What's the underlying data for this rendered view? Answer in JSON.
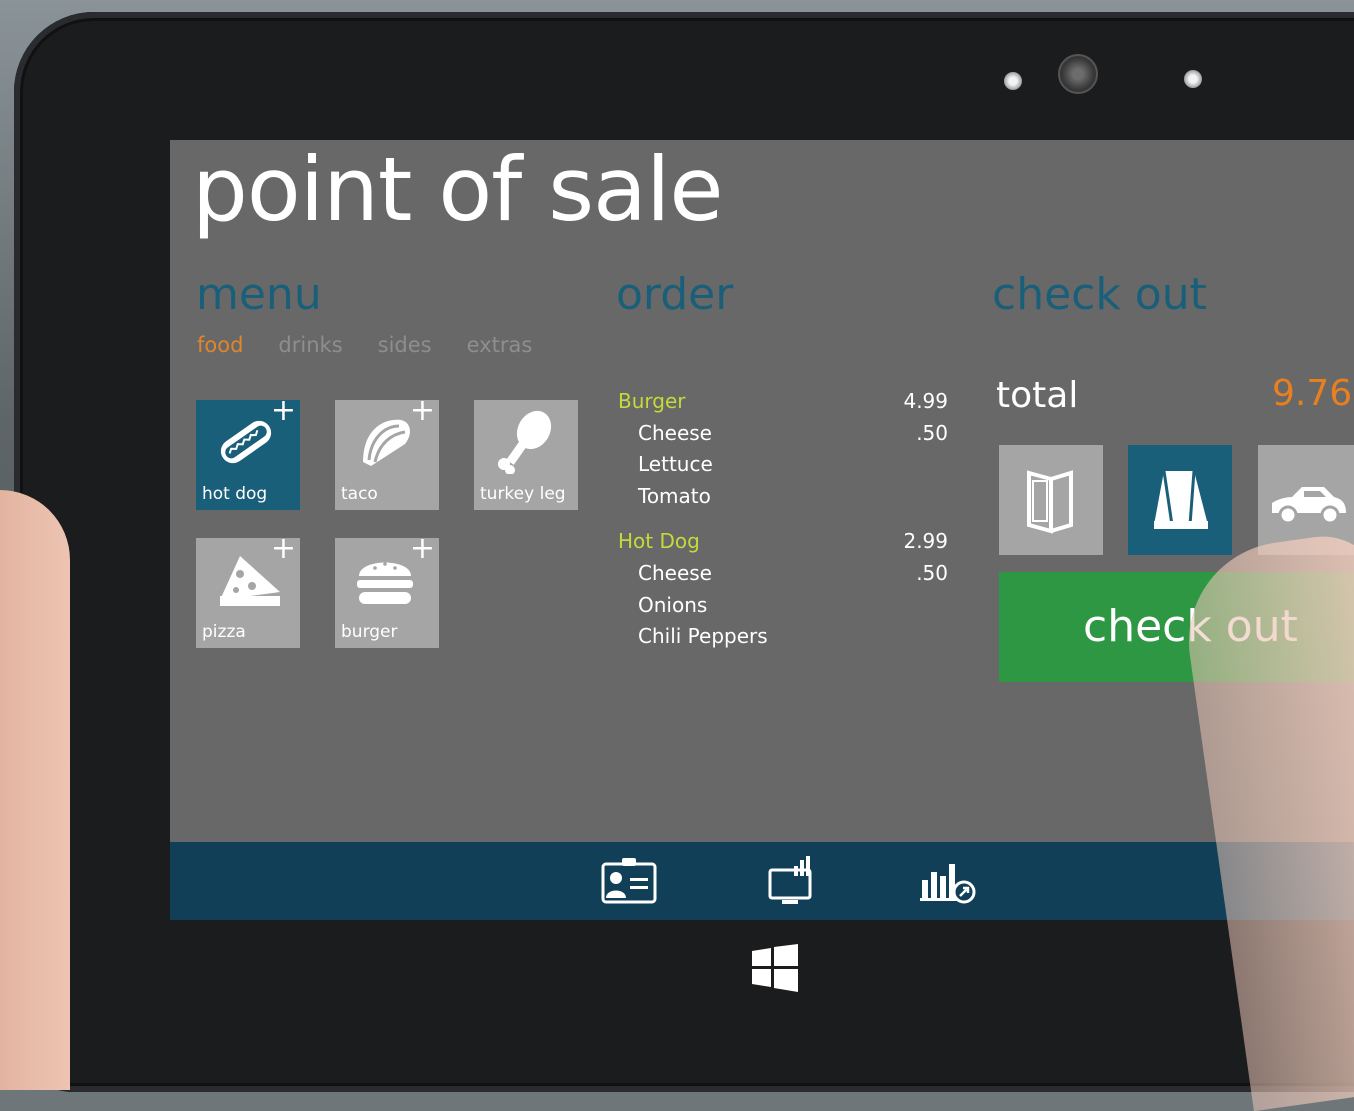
{
  "app": {
    "title": "point of sale"
  },
  "menu": {
    "heading": "menu",
    "tabs": [
      {
        "label": "food",
        "active": true
      },
      {
        "label": "drinks",
        "active": false
      },
      {
        "label": "sides",
        "active": false
      },
      {
        "label": "extras",
        "active": false
      }
    ],
    "items": [
      {
        "label": "hot dog",
        "icon": "hot-dog-icon",
        "selected": true
      },
      {
        "label": "taco",
        "icon": "taco-icon",
        "selected": false
      },
      {
        "label": "turkey leg",
        "icon": "turkey-leg-icon",
        "selected": false
      },
      {
        "label": "pizza",
        "icon": "pizza-icon",
        "selected": false
      },
      {
        "label": "burger",
        "icon": "burger-icon",
        "selected": false
      }
    ],
    "add_symbol": "+"
  },
  "order": {
    "heading": "order",
    "items": [
      {
        "name": "Burger",
        "price": "4.99",
        "modifiers": [
          {
            "name": "Cheese",
            "price": ".50"
          },
          {
            "name": "Lettuce",
            "price": ""
          },
          {
            "name": "Tomato",
            "price": ""
          }
        ]
      },
      {
        "name": "Hot Dog",
        "price": "2.99",
        "modifiers": [
          {
            "name": "Cheese",
            "price": ".50"
          },
          {
            "name": "Onions",
            "price": ""
          },
          {
            "name": "Chili Peppers",
            "price": ""
          }
        ]
      }
    ]
  },
  "checkout": {
    "heading": "check out",
    "total_label": "total",
    "total_value": "9.76",
    "options": [
      {
        "icon": "menu-card-icon",
        "selected": false
      },
      {
        "icon": "takeout-bag-icon",
        "selected": true
      },
      {
        "icon": "car-icon",
        "selected": false
      }
    ],
    "button_label": "check out"
  },
  "bottom_bar": {
    "icons": [
      "employee-badge-icon",
      "register-monitor-icon",
      "sales-report-icon"
    ]
  },
  "device": {
    "home_icon": "windows-logo-icon"
  },
  "colors": {
    "screen_bg": "#686868",
    "heading_blue": "#1a5f7a",
    "active_tab": "#e1852c",
    "order_item": "#c6d93a",
    "total_value": "#e8801f",
    "checkout_green": "#2e9743",
    "bottom_bar": "#113f58",
    "tile_gray": "#a5a5a5"
  }
}
